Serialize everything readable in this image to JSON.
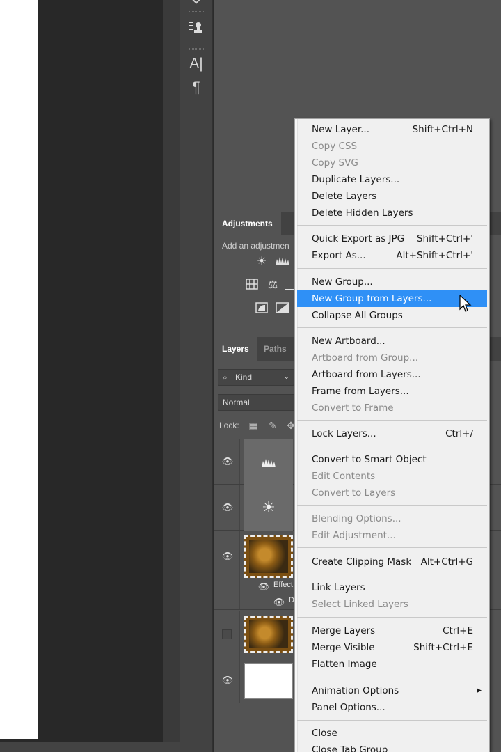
{
  "colors": {
    "menu_bg": "#f0f0f0",
    "menu_highlight": "#2f90f6",
    "panel_bg": "#535353",
    "canvas_bg": "#282828"
  },
  "tools": [
    {
      "icon": "clone-source-icon"
    },
    {
      "icon": "character-panel-icon"
    },
    {
      "icon": "paragraph-panel-icon"
    }
  ],
  "adjustments_panel": {
    "tab_label": "Adjustments",
    "hint": "Add an adjustmen",
    "icons": [
      "brightness-contrast-icon",
      "levels-icon",
      "channel-mixer-icon",
      "balance-icon",
      "invert-icon",
      "gradient-map-icon"
    ]
  },
  "layers_panel": {
    "tabs": [
      "Layers",
      "Paths"
    ],
    "filter_value": "Kind",
    "blend_mode": "Normal",
    "lock_label": "Lock:",
    "effects_label": "Effect",
    "sub_effect_label": "D",
    "layers": [
      {
        "type": "adjustment",
        "icon": "levels-icon",
        "visible": true
      },
      {
        "type": "adjustment",
        "icon": "brightness-contrast-icon",
        "visible": true
      },
      {
        "type": "image",
        "icon": "photo-thumbnail",
        "visible": true
      },
      {
        "type": "image",
        "icon": "photo-thumbnail",
        "visible": false
      },
      {
        "type": "fill",
        "icon": "white-thumbnail",
        "visible": true
      }
    ]
  },
  "context_menu": {
    "items": [
      {
        "label": "New Layer...",
        "shortcut": "Shift+Ctrl+N",
        "disabled": false
      },
      {
        "label": "Copy CSS",
        "shortcut": "",
        "disabled": true
      },
      {
        "label": "Copy SVG",
        "shortcut": "",
        "disabled": true
      },
      {
        "label": "Duplicate Layers...",
        "shortcut": "",
        "disabled": false
      },
      {
        "label": "Delete Layers",
        "shortcut": "",
        "disabled": false
      },
      {
        "label": "Delete Hidden Layers",
        "shortcut": "",
        "disabled": false
      },
      {
        "label": "Quick Export as JPG",
        "shortcut": "Shift+Ctrl+'",
        "disabled": false
      },
      {
        "label": "Export As...",
        "shortcut": "Alt+Shift+Ctrl+'",
        "disabled": false
      },
      {
        "label": "New Group...",
        "shortcut": "",
        "disabled": false
      },
      {
        "label": "New Group from Layers...",
        "shortcut": "",
        "disabled": false,
        "highlighted": true
      },
      {
        "label": "Collapse All Groups",
        "shortcut": "",
        "disabled": false
      },
      {
        "label": "New Artboard...",
        "shortcut": "",
        "disabled": false
      },
      {
        "label": "Artboard from Group...",
        "shortcut": "",
        "disabled": true
      },
      {
        "label": "Artboard from Layers...",
        "shortcut": "",
        "disabled": false
      },
      {
        "label": "Frame from Layers...",
        "shortcut": "",
        "disabled": false
      },
      {
        "label": "Convert to Frame",
        "shortcut": "",
        "disabled": true
      },
      {
        "label": "Lock Layers...",
        "shortcut": "Ctrl+/",
        "disabled": false
      },
      {
        "label": "Convert to Smart Object",
        "shortcut": "",
        "disabled": false
      },
      {
        "label": "Edit Contents",
        "shortcut": "",
        "disabled": true
      },
      {
        "label": "Convert to Layers",
        "shortcut": "",
        "disabled": true
      },
      {
        "label": "Blending Options...",
        "shortcut": "",
        "disabled": true
      },
      {
        "label": "Edit Adjustment...",
        "shortcut": "",
        "disabled": true
      },
      {
        "label": "Create Clipping Mask",
        "shortcut": "Alt+Ctrl+G",
        "disabled": false
      },
      {
        "label": "Link Layers",
        "shortcut": "",
        "disabled": false
      },
      {
        "label": "Select Linked Layers",
        "shortcut": "",
        "disabled": true
      },
      {
        "label": "Merge Layers",
        "shortcut": "Ctrl+E",
        "disabled": false
      },
      {
        "label": "Merge Visible",
        "shortcut": "Shift+Ctrl+E",
        "disabled": false
      },
      {
        "label": "Flatten Image",
        "shortcut": "",
        "disabled": false
      },
      {
        "label": "Animation Options",
        "shortcut": "",
        "disabled": false,
        "submenu": true
      },
      {
        "label": "Panel Options...",
        "shortcut": "",
        "disabled": false
      },
      {
        "label": "Close",
        "shortcut": "",
        "disabled": false
      },
      {
        "label": "Close Tab Group",
        "shortcut": "",
        "disabled": false
      }
    ]
  }
}
